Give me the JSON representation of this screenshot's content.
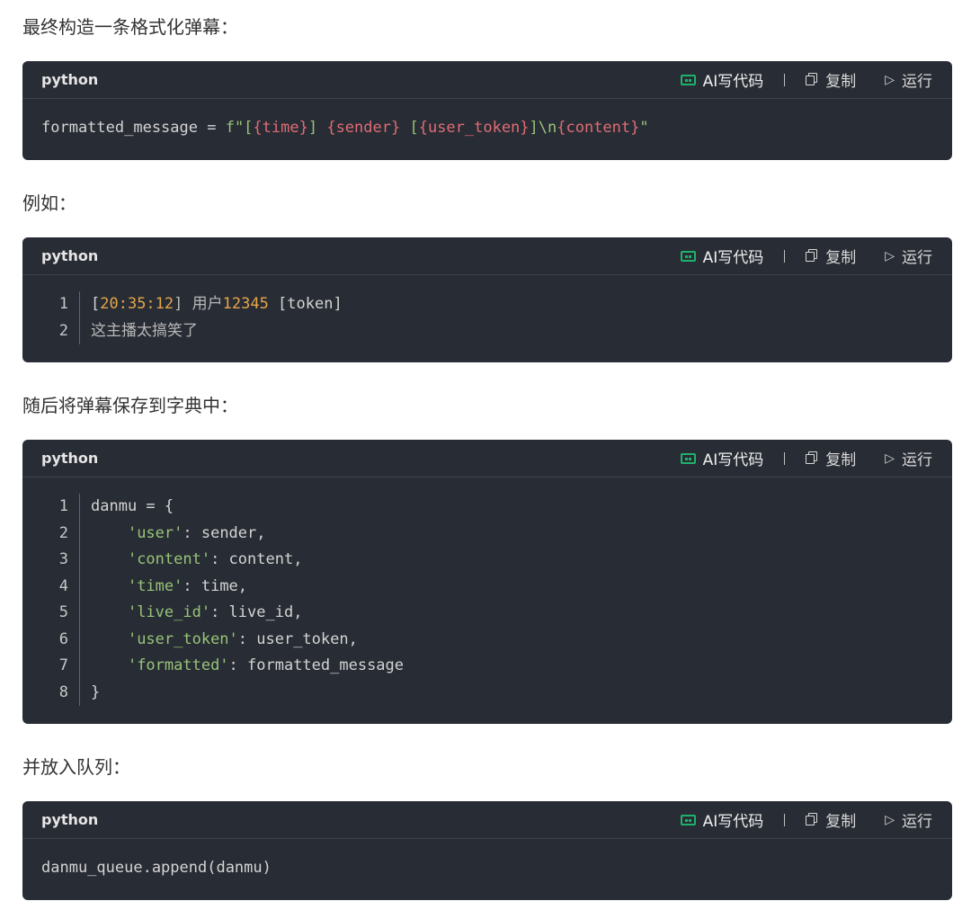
{
  "paragraphs": {
    "p1": "最终构造一条格式化弹幕：",
    "p2": "例如：",
    "p3": "随后将弹幕保存到字典中：",
    "p4": "并放入队列："
  },
  "toolbar": {
    "ai_label": "AI写代码",
    "copy_label": "复制",
    "run_label": "运行"
  },
  "blocks": [
    {
      "lang": "python",
      "code": {
        "lhs": "formatted_message = ",
        "f_prefix": "f\"[",
        "time_var": "{time}",
        "s1": "] ",
        "sender_var": "{sender}",
        "s2": " [",
        "token_var": "{user_token}",
        "s3": "]\\n",
        "content_var": "{content}",
        "s4": "\""
      }
    },
    {
      "lang": "python",
      "lines": [
        {
          "n": "1",
          "pre": "[",
          "time": "20:35:12",
          "mid": "] 用户",
          "uid": "12345",
          "post": " [token]"
        },
        {
          "n": "2",
          "text": "这主播太搞笑了"
        }
      ]
    },
    {
      "lang": "python",
      "lines": [
        {
          "n": "1",
          "text": "danmu = {"
        },
        {
          "n": "2",
          "indent": "    ",
          "key": "'user'",
          "rest": ": sender,"
        },
        {
          "n": "3",
          "indent": "    ",
          "key": "'content'",
          "rest": ": content,"
        },
        {
          "n": "4",
          "indent": "    ",
          "key": "'time'",
          "rest": ": time,"
        },
        {
          "n": "5",
          "indent": "    ",
          "key": "'live_id'",
          "rest": ": live_id,"
        },
        {
          "n": "6",
          "indent": "    ",
          "key": "'user_token'",
          "rest": ": user_token,"
        },
        {
          "n": "7",
          "indent": "    ",
          "key": "'formatted'",
          "rest": ": formatted_message"
        },
        {
          "n": "8",
          "text": "}"
        }
      ]
    },
    {
      "lang": "python",
      "code": "danmu_queue.append(danmu)"
    }
  ],
  "colors": {
    "block_bg": "#282c34",
    "string": "#98c379",
    "variable": "#e06c75",
    "number": "#e5a54b",
    "ai_icon": "#1fb26b"
  }
}
